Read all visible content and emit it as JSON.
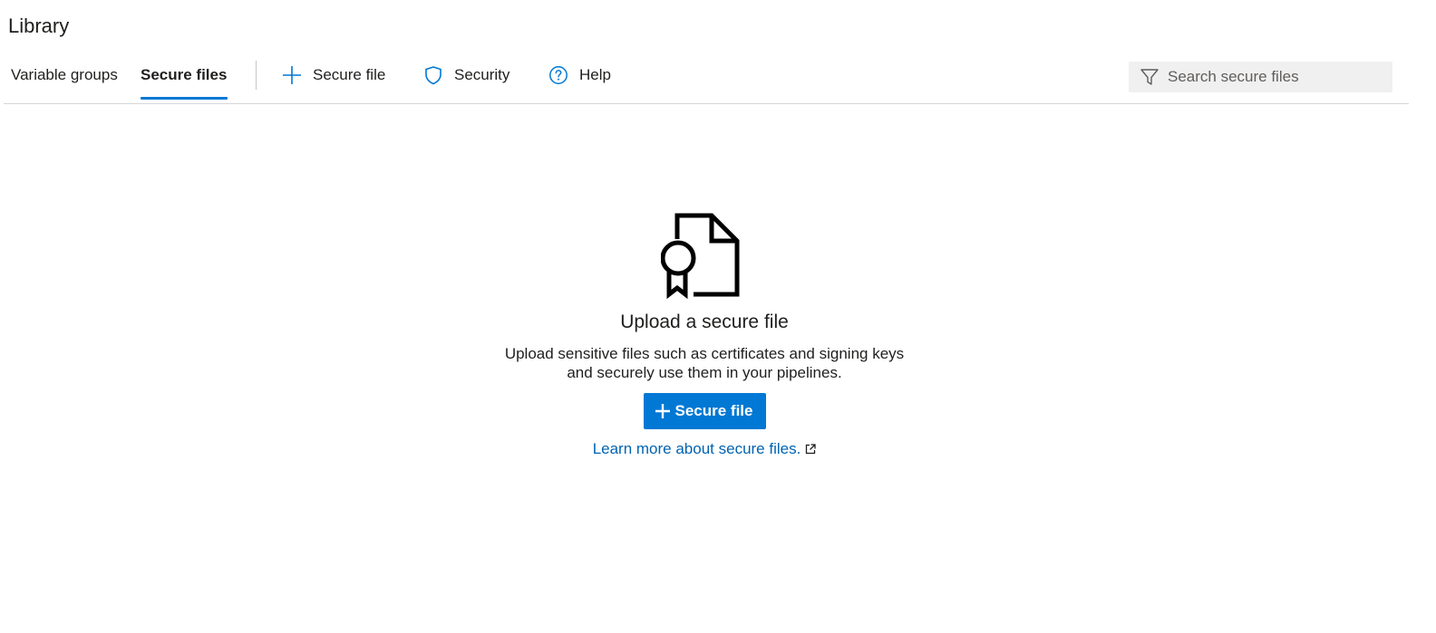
{
  "page": {
    "title": "Library"
  },
  "tabs": [
    {
      "label": "Variable groups",
      "selected": false
    },
    {
      "label": "Secure files",
      "selected": true
    }
  ],
  "commands": {
    "add_secure_file": {
      "label": "Secure file",
      "icon": "plus-icon"
    },
    "security": {
      "label": "Security",
      "icon": "shield-icon"
    },
    "help": {
      "label": "Help",
      "icon": "help-circle-icon"
    }
  },
  "search": {
    "placeholder": "Search secure files",
    "value": "",
    "icon": "filter-icon"
  },
  "empty_state": {
    "icon": "certificate-file-icon",
    "title": "Upload a secure file",
    "description_line1": "Upload sensitive files such as certificates and signing keys",
    "description_line2": "and securely use them in your pipelines.",
    "button_label": "Secure file",
    "link_text": "Learn more about secure files.",
    "link_icon": "external-link-icon"
  },
  "colors": {
    "accent": "#0078d4",
    "link": "#0063b1",
    "text": "#201f1e",
    "search_bg": "#f0f0f0"
  }
}
